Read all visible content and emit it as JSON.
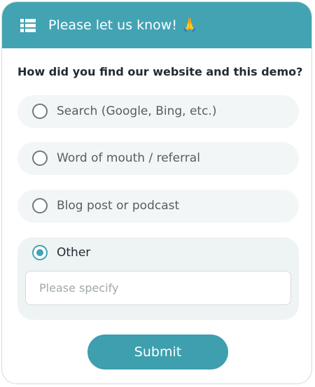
{
  "header": {
    "title": "Please let us know! 🙏",
    "icon": "list-icon"
  },
  "form": {
    "question": "How did you find our website and this demo?",
    "options": [
      {
        "label": "Search (Google, Bing, etc.)",
        "selected": false
      },
      {
        "label": "Word of mouth / referral",
        "selected": false
      },
      {
        "label": "Blog post or podcast",
        "selected": false
      },
      {
        "label": "Other",
        "selected": true
      }
    ],
    "other_input": {
      "value": "",
      "placeholder": "Please specify"
    },
    "submit_label": "Submit"
  },
  "colors": {
    "accent": "#42a3b3",
    "option_background": "#f3f6f6",
    "text": "#222b33"
  }
}
